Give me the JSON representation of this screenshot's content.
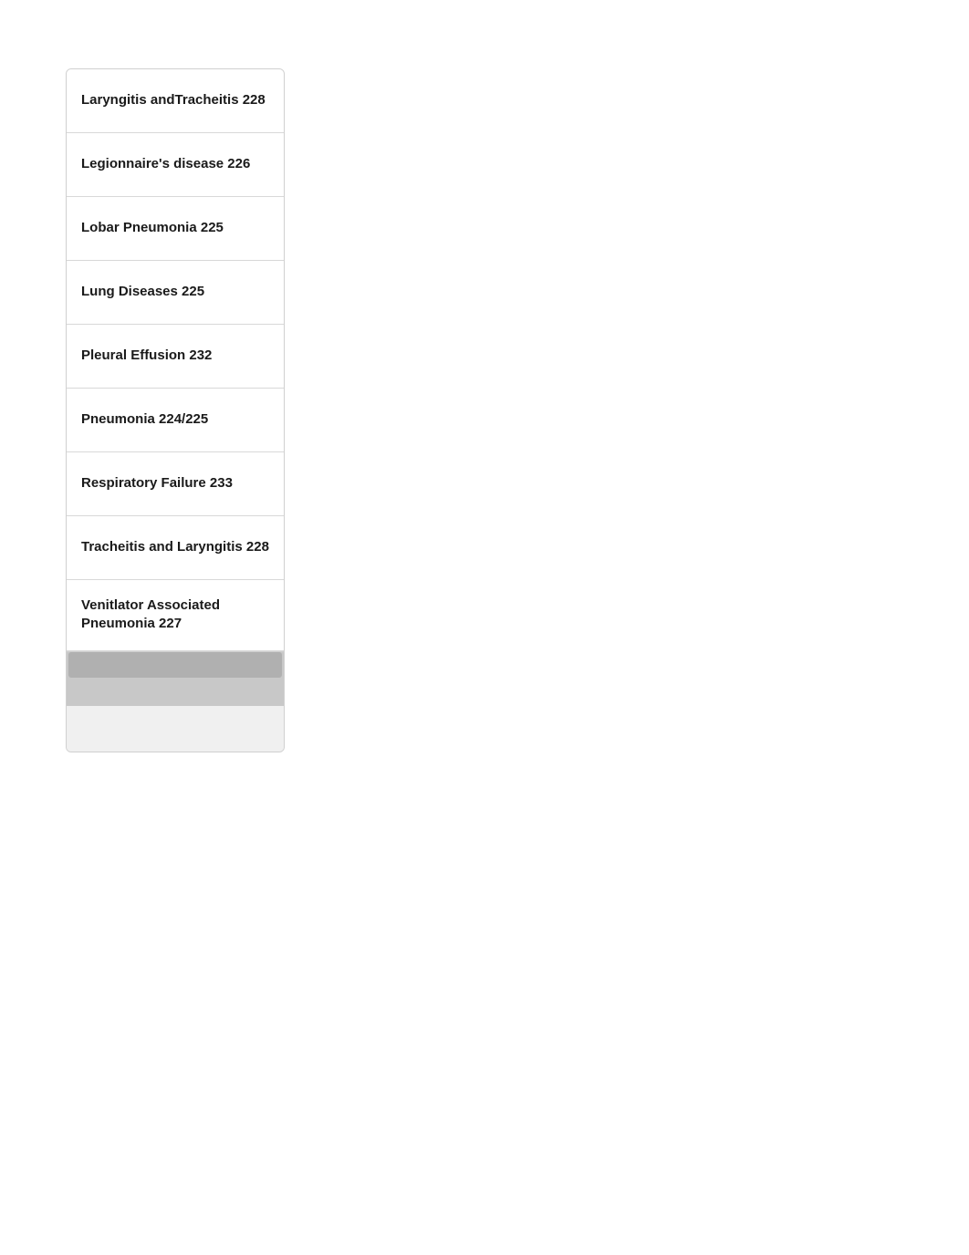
{
  "panel": {
    "items": [
      {
        "id": "laryngitis",
        "label": "Laryngitis andTracheitis 228"
      },
      {
        "id": "legionnaire",
        "label": "Legionnaire's disease 226"
      },
      {
        "id": "lobar-pneumonia",
        "label": "Lobar Pneumonia 225"
      },
      {
        "id": "lung-diseases",
        "label": "Lung Diseases 225"
      },
      {
        "id": "pleural-effusion",
        "label": "Pleural Effusion 232"
      },
      {
        "id": "pneumonia",
        "label": "Pneumonia 224/225"
      },
      {
        "id": "respiratory-failure",
        "label": "Respiratory Failure 233"
      },
      {
        "id": "tracheitis",
        "label": "Tracheitis and Laryngitis 228"
      },
      {
        "id": "ventilator",
        "label": "Venitlator Associated Pneumonia 227"
      }
    ]
  }
}
